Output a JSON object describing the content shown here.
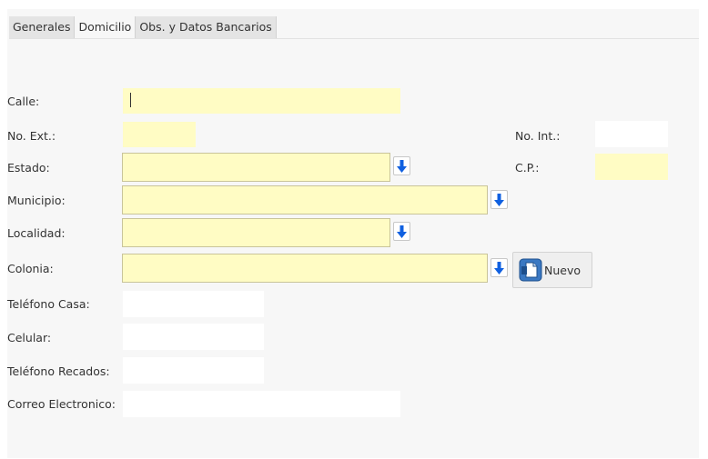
{
  "tabs": [
    {
      "label": "Generales"
    },
    {
      "label": "Domicilio"
    },
    {
      "label": "Obs. y Datos Bancarios"
    }
  ],
  "form": {
    "calle": {
      "label": "Calle:",
      "value": ""
    },
    "no_ext": {
      "label": "No. Ext.:",
      "value": ""
    },
    "no_int": {
      "label": "No. Int.:",
      "value": ""
    },
    "estado": {
      "label": "Estado:",
      "value": ""
    },
    "cp": {
      "label": "C.P.:",
      "value": ""
    },
    "municipio": {
      "label": "Municipio:",
      "value": ""
    },
    "localidad": {
      "label": "Localidad:",
      "value": ""
    },
    "colonia": {
      "label": "Colonia:",
      "value": ""
    },
    "telefono_casa": {
      "label": "Teléfono Casa:",
      "value": ""
    },
    "celular": {
      "label": "Celular:",
      "value": ""
    },
    "telefono_recados": {
      "label": "Teléfono Recados:",
      "value": ""
    },
    "correo": {
      "label": "Correo Electronico:",
      "value": ""
    }
  },
  "buttons": {
    "nuevo_label": "Nuevo"
  },
  "icons": {
    "dropdown": "arrow-down-icon",
    "new_document": "new-document-icon"
  },
  "colors": {
    "required_field": "#fffcc4",
    "arrow": "#1060e0"
  }
}
